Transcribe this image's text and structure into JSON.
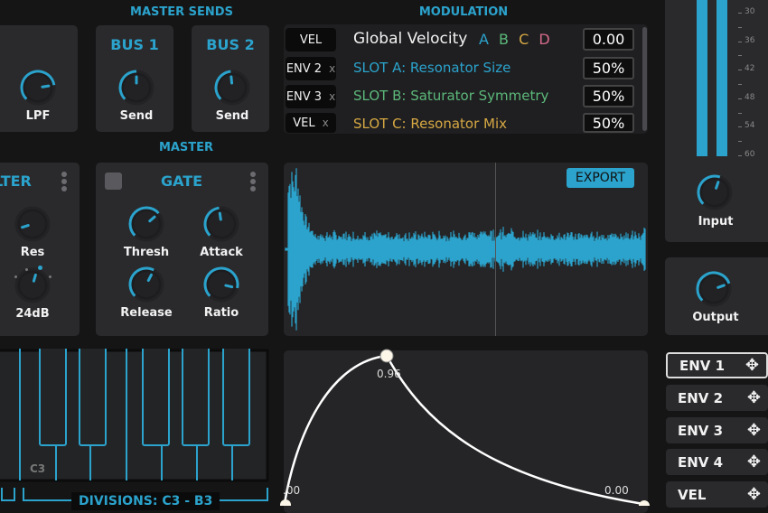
{
  "sections": {
    "master_sends": "MASTER SENDS",
    "master": "MASTER",
    "modulation": "MODULATION"
  },
  "colors": {
    "accent": "#2ba3cc",
    "slot_a": "#2ba3cc",
    "slot_b": "#5cb87a",
    "slot_c": "#d6a843",
    "slot_d": "#d46a8a"
  },
  "lpf": {
    "label": "LPF",
    "value": 0.8
  },
  "bus1": {
    "title": "BUS 1",
    "label": "Send",
    "value": 0.5
  },
  "bus2": {
    "title": "BUS 2",
    "label": "Send",
    "value": 0.48
  },
  "filter": {
    "title": "LTER",
    "res_label": "Res",
    "res_value": 0.1,
    "slope_label": "24dB",
    "slope_value": 0.56
  },
  "gate": {
    "title": "GATE",
    "enabled": false,
    "knobs": [
      {
        "label": "Thresh",
        "value": 0.68
      },
      {
        "label": "Attack",
        "value": 0.47
      },
      {
        "label": "Release",
        "value": 0.6
      },
      {
        "label": "Ratio",
        "value": 0.88
      }
    ]
  },
  "modulation": {
    "header": {
      "source": "VEL",
      "title": "Global Velocity",
      "letters": [
        "A",
        "B",
        "C",
        "D"
      ],
      "value": "0.00"
    },
    "rows": [
      {
        "source": "ENV 2",
        "remove": "x",
        "label": "SLOT A: Resonator Size",
        "value": "50%"
      },
      {
        "source": "ENV 3",
        "remove": "x",
        "label": "SLOT B: Saturator Symmetry",
        "value": "50%"
      },
      {
        "source": "VEL",
        "remove": "x",
        "label": "SLOT C: Resonator Mix",
        "value": "50%"
      }
    ]
  },
  "waveform": {
    "export_label": "EXPORT"
  },
  "meter": {
    "scale": [
      "30",
      "36",
      "42",
      "48",
      "54",
      "60"
    ],
    "input_label": "Input",
    "input_value": 0.57,
    "output_label": "Output",
    "output_value": 0.76
  },
  "envelope": {
    "peak_label": "0.96",
    "start_label": ".00",
    "end_label": "0.00"
  },
  "env_sources": [
    {
      "label": "ENV 1",
      "selected": true
    },
    {
      "label": "ENV 2"
    },
    {
      "label": "ENV 3"
    },
    {
      "label": "ENV 4"
    },
    {
      "label": "VEL"
    }
  ],
  "keyboard": {
    "note_label": "C3",
    "divisions_label": "DIVISIONS: C3 - B3"
  }
}
